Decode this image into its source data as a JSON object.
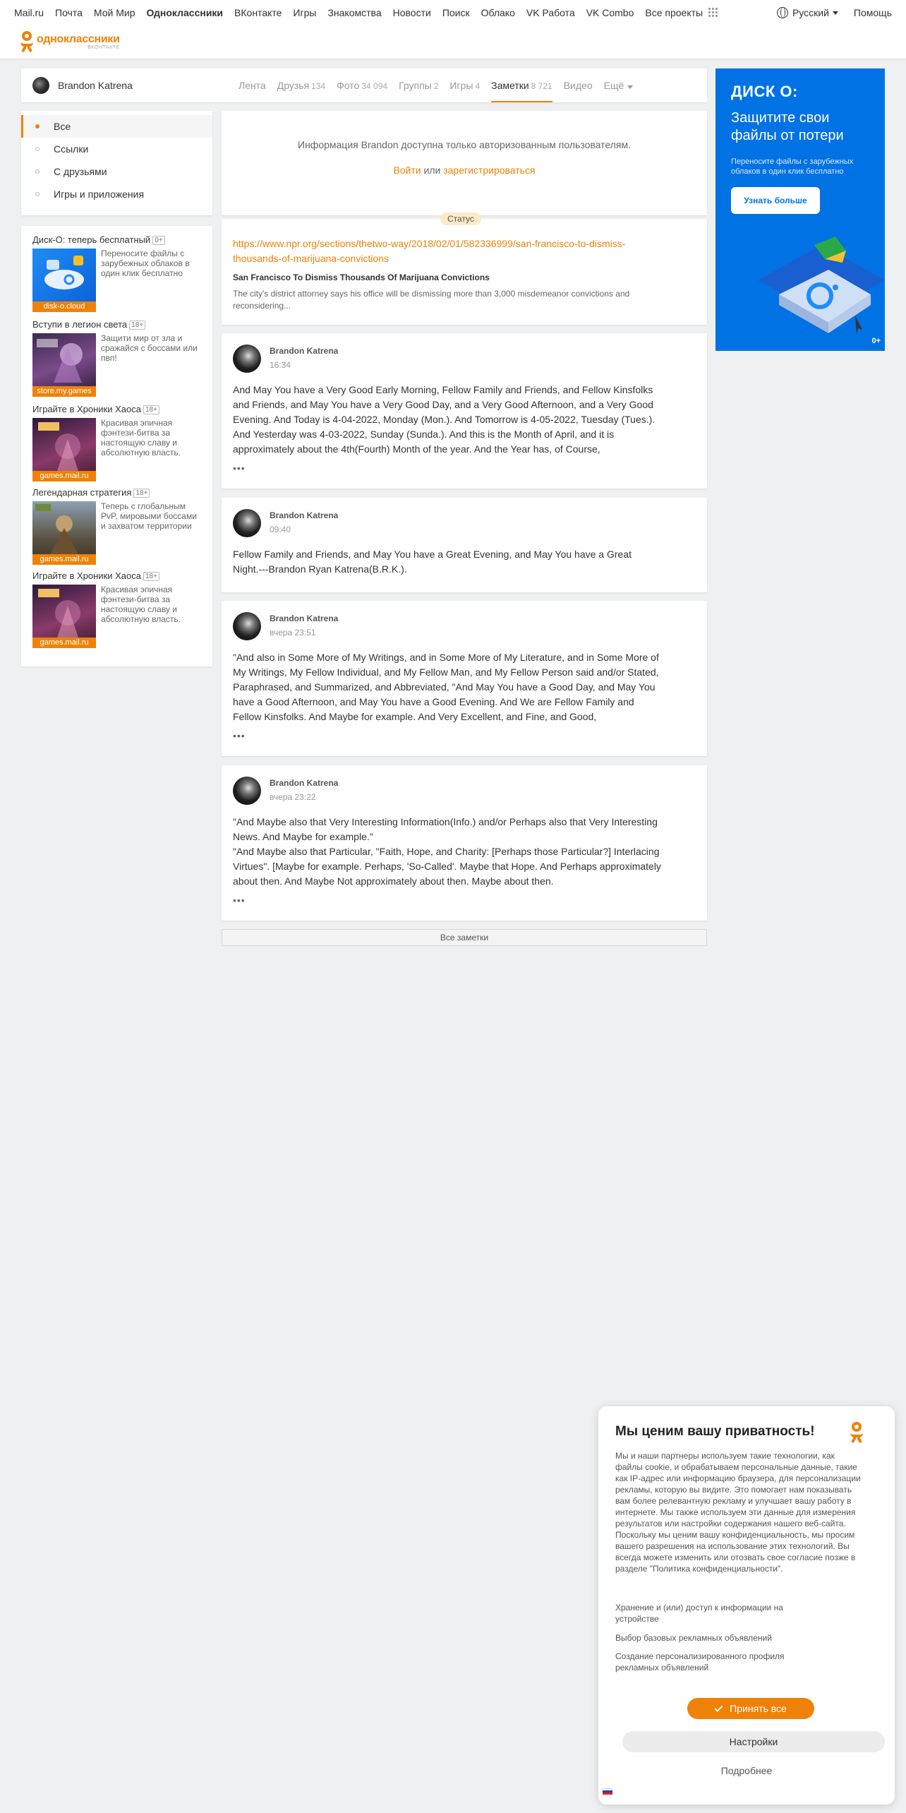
{
  "topbar": {
    "links": [
      "Mail.ru",
      "Почта",
      "Мой Мир",
      "Одноклассники",
      "ВКонтакте",
      "Игры",
      "Знакомства",
      "Новости",
      "Поиск",
      "Облако",
      "VK Работа",
      "VK Combo",
      "Все проекты"
    ],
    "language": "Русский",
    "help": "Помощь"
  },
  "logo": {
    "name": "одноклассники",
    "sub": "ВКОНТАКТЕ"
  },
  "profile_nav": {
    "name": "Brandon Katrena",
    "tabs": [
      {
        "label": "Лента",
        "count": ""
      },
      {
        "label": "Друзья",
        "count": "134"
      },
      {
        "label": "Фото",
        "count": "34 094"
      },
      {
        "label": "Группы",
        "count": "2"
      },
      {
        "label": "Игры",
        "count": "4"
      },
      {
        "label": "Заметки",
        "count": "8 721"
      },
      {
        "label": "Видео",
        "count": ""
      },
      {
        "label": "Ещё",
        "count": ""
      }
    ]
  },
  "filters": [
    "Все",
    "Ссылки",
    "С друзьями",
    "Игры и приложения"
  ],
  "ads": [
    {
      "title": "Диск-О: теперь бесплатный",
      "age": "0+",
      "desc": "Переносите файлы с зарубежных облаков в один клик бесплатно",
      "source": "disk-o.cloud"
    },
    {
      "title": "Вступи в легион света",
      "age": "18+",
      "desc": "Защити мир от зла и сражайся с боссами или пвп!",
      "source": "store.my.games"
    },
    {
      "title": "Играйте в Хроники Хаоса",
      "age": "18+",
      "desc": "Красивая эпичная фэнтези-битва за настоящую славу и абсолютную власть.",
      "source": "games.mail.ru"
    },
    {
      "title": "Легендарная стратегия",
      "age": "18+",
      "desc": "Теперь с глобальным PvP, мировыми боссами и захватом территории",
      "source": "games.mail.ru"
    },
    {
      "title": "Играйте в Хроники Хаоса",
      "age": "18+",
      "desc": "Красивая эпичная фэнтези-битва за настоящую славу и абсолютную власть.",
      "source": "games.mail.ru"
    }
  ],
  "auth_info": {
    "message": "Информация Brandon доступна только авторизованным пользователям.",
    "login": "Войти",
    "or": "или",
    "register": "зарегистрироваться"
  },
  "status": {
    "badge": "Статус",
    "link": "https://www.npr.org/sections/thetwo-way/2018/02/01/582336999/san-francisco-to-dismiss-thousands-of-marijuana-convictions",
    "title": "San Francisco To Dismiss Thousands Of Marijuana Convictions",
    "description": "The city's district attorney says his office will be dismissing more than 3,000 misdemeanor convictions and reconsidering..."
  },
  "notes": [
    {
      "author": "Brandon Katrena",
      "time": "16:34",
      "text": "And May You have a Very Good Early Morning, Fellow Family and Friends, and Fellow Kinsfolks and Friends, and May You have a Very Good Day, and a Very Good Afternoon, and a Very Good Evening. And Today is 4-04-2022, Monday (Mon.). And Tomorrow is 4-05-2022, Tuesday (Tues.). And Yesterday was 4-03-2022, Sunday (Sunda.). And this is the Month of April, and it is approximately about the 4th(Fourth) Month of the year. And the Year has, of Course,",
      "more": "•••"
    },
    {
      "author": "Brandon Katrena",
      "time": "09:40",
      "text": "Fellow Family and Friends,  and May You have a Great Evening, and May You have a Great Night.---Brandon Ryan Katrena(B.R.K.).",
      "more": ""
    },
    {
      "author": "Brandon Katrena",
      "time": "вчера 23:51",
      "text": "\"And also in Some More of My Writings, and in Some More of My Literature, and in Some More of My Writings, My Fellow Individual, and My Fellow Man, and My Fellow Person said and/or Stated, Paraphrased, and Summarized, and Abbreviated, \"And May You have a Good Day, and May You have a Good Afternoon, and May You have a Good Evening. And We are Fellow Family and Fellow Kinsfolks. And Maybe for example. And Very Excellent, and Fine, and Good,",
      "more": "•••"
    },
    {
      "author": "Brandon Katrena",
      "time": "вчера 23:22",
      "text": "\"And Maybe also that Very Interesting Information(Info.) and/or Perhaps also that Very Interesting News. And Maybe for example.\"\n\"And Maybe also that Particular, \"Faith, Hope, and Charity: [Perhaps those Particular?] Interlacing Virtues\". [Maybe for example. Perhaps, 'So-Called'. Maybe that Hope. And Perhaps approximately about then. And Maybe Not approximately about then. Maybe about then.",
      "more": "•••"
    }
  ],
  "all_notes": "Все заметки",
  "banner": {
    "brand": "ДИСК О:",
    "headline": "Защитите свои файлы от потери",
    "sub": "Переносите файлы с зарубежных облаков в один клик бесплатно",
    "button": "Узнать больше",
    "age": "0+"
  },
  "privacy": {
    "title": "Мы ценим вашу приватность!",
    "text": "Мы и наши партнеры используем такие технологии, как файлы cookie, и обрабатываем персональные данные, такие как IP-адрес или информацию браузера, для персонализации рекламы, которую вы видите. Это помогает нам показывать вам более релевантную рекламу и улучшает вашу работу в интернете. Мы также используем эти данные для измерения результатов или настройки содержания нашего веб-сайта. Поскольку мы ценим вашу конфиденциальность, мы просим вашего разрешения на использование этих технологий. Вы всегда можете изменить или отозвать свое согласие позже в разделе \"Политика конфиденциальности\".",
    "options": [
      "Хранение и (или) доступ к информации на устройстве",
      "Выбор базовых рекламных объявлений",
      "Создание персонализированного профиля рекламных объявлений"
    ],
    "accept": "Принять все",
    "settings": "Настройки",
    "details": "Подробнее"
  },
  "colors": {
    "accent": "#ee8208",
    "banner": "#0072e4",
    "background": "#eff0f1"
  }
}
